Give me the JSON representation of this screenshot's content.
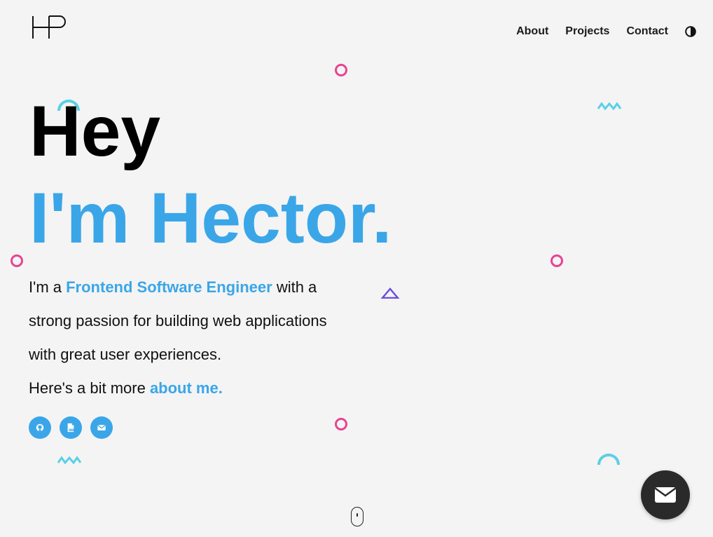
{
  "logo": {
    "alt": "HP"
  },
  "nav": {
    "items": [
      {
        "label": "About"
      },
      {
        "label": "Projects"
      },
      {
        "label": "Contact"
      }
    ],
    "theme_toggle_icon": "contrast-icon"
  },
  "hero": {
    "greeting": "Hey",
    "name_line": "I'm Hector.",
    "intro_prefix": "I'm a ",
    "role": "Frontend Software Engineer",
    "intro_middle": " with a strong passion for building web applications with great user experiences.",
    "intro_more": "Here's a bit more ",
    "about_link": "about me."
  },
  "socials": [
    {
      "icon": "github-icon"
    },
    {
      "icon": "pdf-resume-icon"
    },
    {
      "icon": "envelope-icon"
    }
  ],
  "fab": {
    "icon": "envelope-icon"
  },
  "colors": {
    "accent": "#3aa6e8",
    "ring": "#e84393",
    "arc": "#5ad0e6",
    "triangle": "#6a4fe0",
    "background": "#f4f4f4",
    "fab": "#2a2a2a"
  }
}
